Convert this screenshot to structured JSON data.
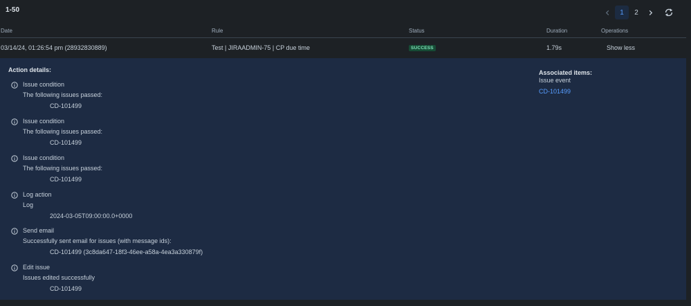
{
  "header": {
    "count_label": "1-50"
  },
  "pagination": {
    "pages": [
      "1",
      "2"
    ],
    "active_page": "1"
  },
  "table": {
    "columns": {
      "date": "Date",
      "rule": "Rule",
      "status": "Status",
      "duration": "Duration",
      "operations": "Operations"
    },
    "row": {
      "date": "03/14/24, 01:26:54 pm (28932830889)",
      "rule": "Test | JIRAADMIN-75 | CP due time",
      "status": "SUCCESS",
      "duration": "1.79s",
      "operation": "Show less"
    }
  },
  "details": {
    "title": "Action details:",
    "actions": [
      {
        "title": "Issue condition",
        "subtitle": "The following issues passed:",
        "value": "CD-101499"
      },
      {
        "title": "Issue condition",
        "subtitle": "The following issues passed:",
        "value": "CD-101499"
      },
      {
        "title": "Issue condition",
        "subtitle": "The following issues passed:",
        "value": "CD-101499"
      },
      {
        "title": "Log action",
        "subtitle": "Log",
        "value": "2024-03-05T09:00:00.0+0000"
      },
      {
        "title": "Send email",
        "subtitle": "Successfully sent email for issues (with message ids):",
        "value": "CD-101499 (3c8da647-18f3-46ee-a58a-4ea3a330879f)"
      },
      {
        "title": "Edit issue",
        "subtitle": "Issues edited successfully",
        "value": "CD-101499"
      }
    ],
    "associated": {
      "title": "Associated items:",
      "subtitle": "Issue event",
      "link": "CD-101499"
    }
  },
  "colors": {
    "background": "#1d2125",
    "details_bg": "#1d2b43",
    "link": "#579dff",
    "success_bg": "#164b35",
    "success_fg": "#7ee2b8"
  },
  "icons": {
    "prev": "chevron-left-icon",
    "next": "chevron-right-icon",
    "refresh": "refresh-icon",
    "info": "info-icon"
  }
}
